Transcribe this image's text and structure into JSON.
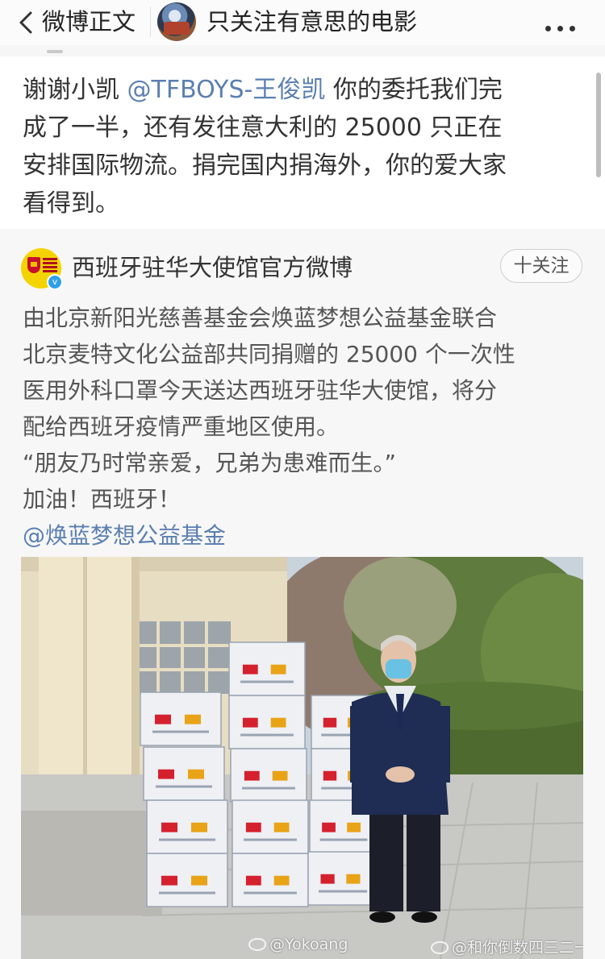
{
  "nav": {
    "back_label": "微博正文",
    "user_name": "只关注有意思的电影",
    "more_icon": "more-icon"
  },
  "post": {
    "lines": [
      [
        {
          "t": "谢谢小凯 "
        },
        {
          "t": "@TFBOYS-王俊凯",
          "m": true
        },
        {
          "t": " 你的委托我们完"
        }
      ],
      [
        {
          "t": "成了一半，还有发往意大利的 25000 只正在"
        }
      ],
      [
        {
          "t": "安排国际物流。捐完国内捐海外，你的爱大家"
        }
      ],
      [
        {
          "t": "看得到。"
        }
      ]
    ]
  },
  "repost": {
    "author": "西班牙驻华大使馆官方微博",
    "follow_label": "十关注",
    "lines": [
      "由北京新阳光慈善基金会焕蓝梦想公益基金联合",
      "北京麦特文化公益部共同捐赠的 25000 个一次性",
      "医用外科口罩今天送达西班牙驻华大使馆，将分",
      "配给西班牙疫情严重地区使用。",
      "“朋友乃时常亲爱，兄弟为患难而生。”",
      "加油！西班牙！"
    ],
    "mention": "@焕蓝梦想公益基金"
  },
  "photo": {
    "watermark_1": "@Yokoang",
    "watermark_2": "@和你倒数四三二一"
  },
  "colors": {
    "link": "#5b7fb0",
    "body_text": "#333333",
    "repost_text": "#555555",
    "repost_bg": "#f7f7f7"
  }
}
